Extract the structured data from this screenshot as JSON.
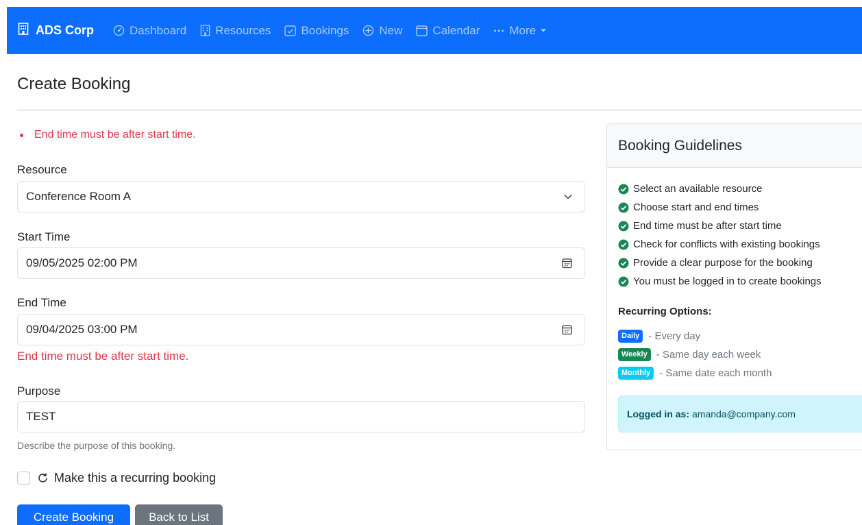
{
  "nav": {
    "brand": "ADS Corp",
    "items": [
      {
        "label": "Dashboard",
        "icon": "speedometer-icon"
      },
      {
        "label": "Resources",
        "icon": "building-icon"
      },
      {
        "label": "Bookings",
        "icon": "calendar-check-icon"
      },
      {
        "label": "New",
        "icon": "plus-circle-icon"
      },
      {
        "label": "Calendar",
        "icon": "calendar-icon"
      },
      {
        "label": "More",
        "icon": "dots-icon"
      }
    ]
  },
  "page": {
    "title": "Create Booking"
  },
  "form": {
    "error_summary": "End time must be after start time.",
    "resource": {
      "label": "Resource",
      "value": "Conference Room A"
    },
    "start": {
      "label": "Start Time",
      "value": "09/05/2025 02:00 PM"
    },
    "end": {
      "label": "End Time",
      "value": "09/04/2025 03:00 PM",
      "error": "End time must be after start time."
    },
    "purpose": {
      "label": "Purpose",
      "value": "TEST",
      "help": "Describe the purpose of this booking."
    },
    "recurring_label": "Make this a recurring booking",
    "submit_label": "Create Booking",
    "back_label": "Back to List"
  },
  "guidelines": {
    "title": "Booking Guidelines",
    "items": [
      "Select an available resource",
      "Choose start and end times",
      "End time must be after start time",
      "Check for conflicts with existing bookings",
      "Provide a clear purpose for the booking",
      "You must be logged in to create bookings"
    ],
    "recurring_title": "Recurring Options:",
    "options": [
      {
        "badge": "Daily",
        "desc": "- Every day",
        "color": "#0d6efd"
      },
      {
        "badge": "Weekly",
        "desc": "- Same day each week",
        "color": "#198754"
      },
      {
        "badge": "Monthly",
        "desc": "- Same date each month",
        "color": "#0dcaf0"
      }
    ],
    "logged_in_label": "Logged in as:",
    "logged_in_user": "amanda@company.com"
  },
  "colors": {
    "primary": "#0d6efd",
    "danger": "#dc3545",
    "success": "#198754",
    "info_bg": "#cff4fc"
  }
}
